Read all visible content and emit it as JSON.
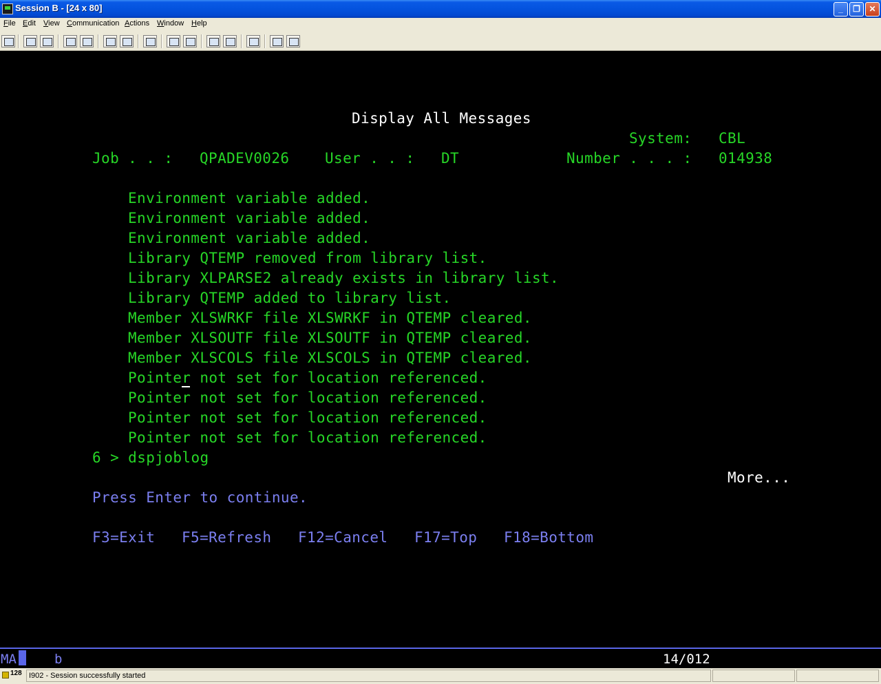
{
  "window": {
    "title": "Session B - [24 x 80]",
    "minimize_glyph": "_",
    "restore_glyph": "❐",
    "close_glyph": "✕"
  },
  "menu": {
    "items": [
      "File",
      "Edit",
      "View",
      "Communication",
      "Actions",
      "Window",
      "Help"
    ]
  },
  "terminal": {
    "title": "Display All Messages",
    "system_label": "System:",
    "system_value": "CBL",
    "job_label": "Job . . :",
    "job_value": "QPADEV0026",
    "user_label": "User . . :",
    "user_value": "DT",
    "number_label": "Number . . . :",
    "number_value": "014938",
    "messages": [
      "Environment variable added.",
      "Environment variable added.",
      "Environment variable added.",
      "Library QTEMP removed from library list.",
      "Library XLPARSE2 already exists in library list.",
      "Library QTEMP added to library list.",
      "Member XLSWRKF file XLSWRKF in QTEMP cleared.",
      "Member XLSOUTF file XLSOUTF in QTEMP cleared.",
      "Member XLSCOLS file XLSCOLS in QTEMP cleared.",
      "Pointer not set for location referenced.",
      "Pointer not set for location referenced.",
      "Pointer not set for location referenced.",
      "Pointer not set for location referenced."
    ],
    "command_line": "6 > dspjoblog",
    "more": "More...",
    "instruction": "Press Enter to continue.",
    "function_keys": [
      "F3=Exit",
      "F5=Refresh",
      "F12=Cancel",
      "F17=Top",
      "F18=Bottom"
    ]
  },
  "oia": {
    "indicator": "MA",
    "keyboard": "b",
    "cursor_position": "14/012"
  },
  "statusbar": {
    "count": "128",
    "message": "I902 - Session successfully started"
  }
}
